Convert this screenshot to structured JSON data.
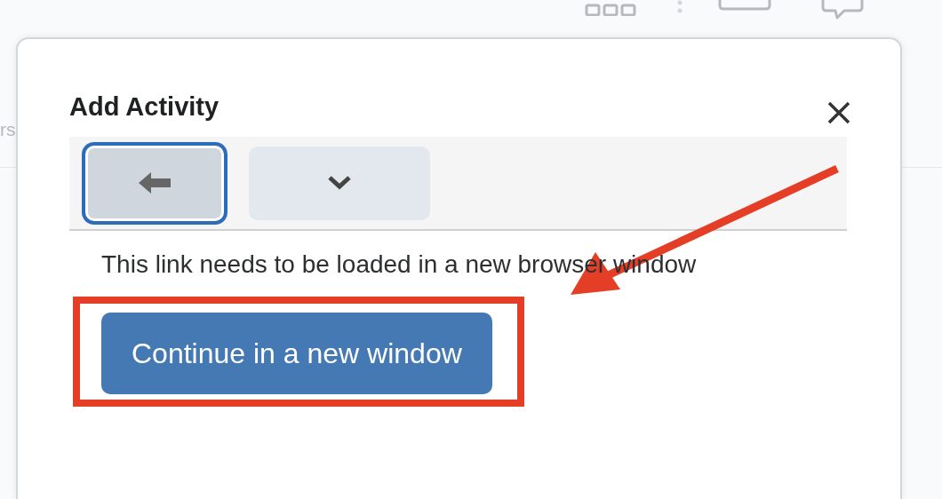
{
  "background_page": {
    "fragments": [
      "rs"
    ]
  },
  "dialog": {
    "title": "Add Activity",
    "toolbar": [
      {
        "kind": "back",
        "focused": true
      },
      {
        "kind": "dropdown",
        "focused": false
      }
    ],
    "message": "This link needs to be loaded in a new browser window",
    "button": "Continue in a new window"
  }
}
